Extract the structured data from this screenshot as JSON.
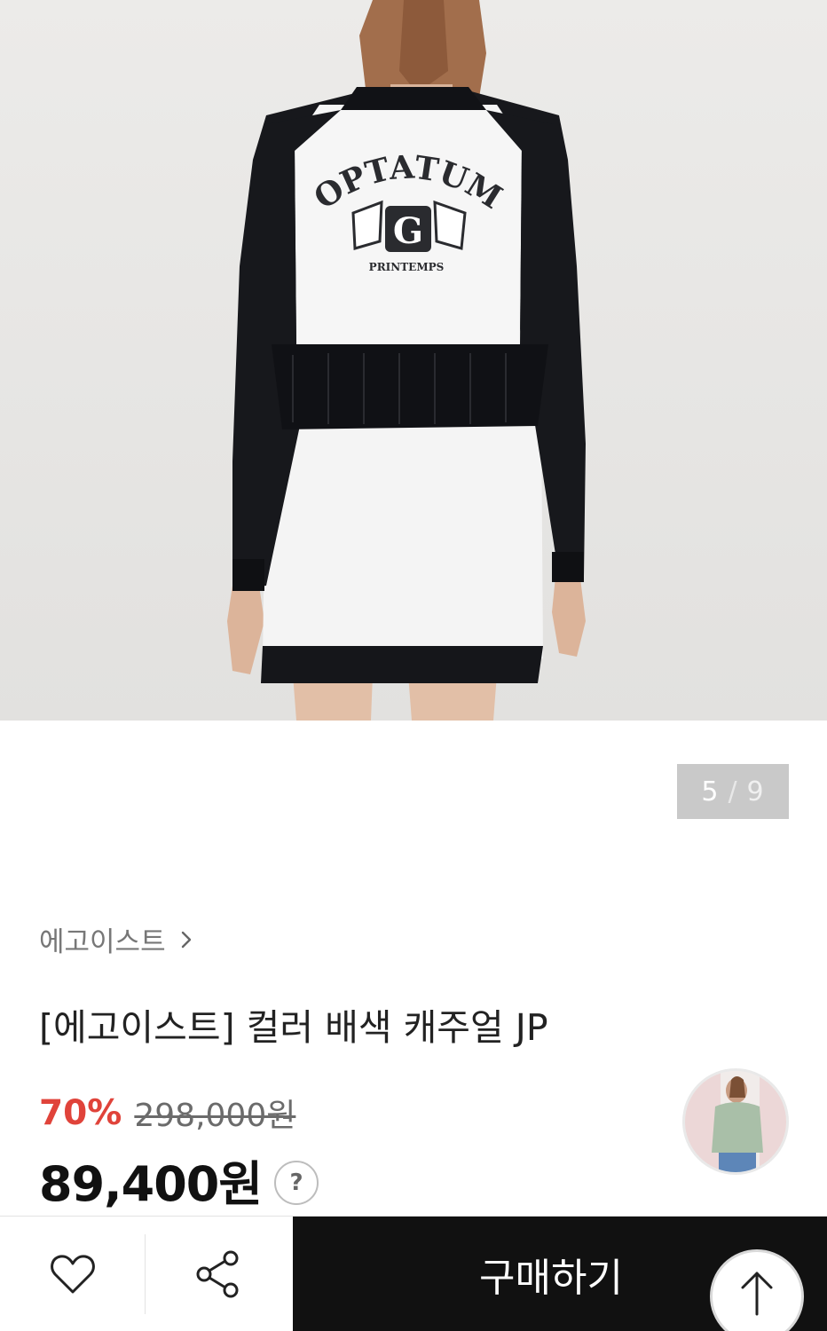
{
  "gallery": {
    "current": "5",
    "separator": "/",
    "total": "9",
    "garment_print": {
      "top_text": "OPTATUM",
      "badge_letter": "G",
      "bottom_text": "PRINTEMPS"
    }
  },
  "brand": {
    "name": "에고이스트",
    "link_icon": "chevron-right-icon"
  },
  "product": {
    "title": "[에고이스트] 컬러 배색 캐주얼 JP",
    "discount": "70%",
    "original_price": "298,000원",
    "final_price": "89,400원",
    "help_label": "?"
  },
  "bottom_bar": {
    "like_icon": "heart-icon",
    "share_icon": "share-icon",
    "buy_label": "구매하기",
    "scroll_top_icon": "arrow-up-icon"
  },
  "colors": {
    "discount": "#e0433a",
    "buy_button": "#111111",
    "counter_bg": "#c9c9c9"
  }
}
